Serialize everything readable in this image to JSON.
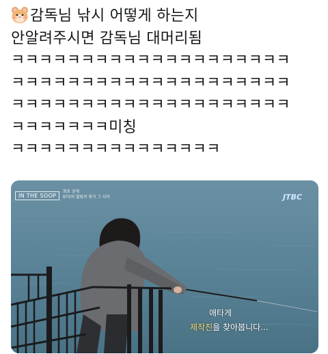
{
  "tweet": {
    "emoji": "hamster-face-icon",
    "lines": [
      "감독님 낚시 어떻게 하는지",
      "안알려주시면 감독님 대머리됨",
      "ㅋㅋㅋㅋㅋㅋㅋㅋㅋㅋㅋㅋㅋㅋㅋㅋㅋㅋㅋㅋ",
      "ㅋㅋㅋㅋㅋㅋㅋㅋㅋㅋㅋㅋㅋㅋㅋㅋㅋㅋㅋㅋ",
      "ㅋㅋㅋㅋㅋㅋㅋㅋㅋㅋㅋㅋㅋㅋㅋㅋㅋㅋㅋㅋ",
      "ㅋㅋㅋㅋㅋㅋㅋ미칭",
      "ㅋㅋㅋㅋㅋㅋㅋㅋㅋㅋㅋㅋㅋㅋㅋ"
    ]
  },
  "media": {
    "show_logo": "IN THE SOOP",
    "episode_tag_1": "최초 공개",
    "episode_tag_2": "BTS의 힐링과 휴가 그 사이",
    "channel_logo": "JTBC",
    "caption_line1": "애타게",
    "caption_line2_highlight": "제작진",
    "caption_line2_rest": "을 찾아봅니다..."
  }
}
